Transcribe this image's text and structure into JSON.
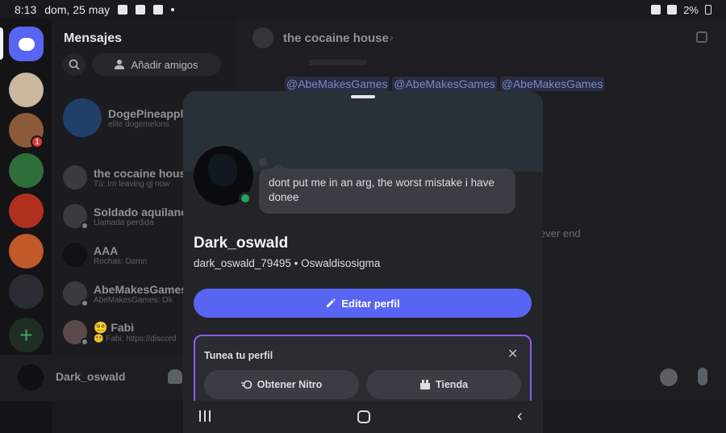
{
  "status_bar": {
    "time": "8:13",
    "date": "dom, 25 may",
    "battery": "2%"
  },
  "dm_panel": {
    "title": "Mensajes",
    "add_friends_label": "Añadir amigos",
    "items": [
      {
        "name": "DogePineapple2",
        "sub": "elite dogemelons"
      },
      {
        "name": "the cocaine house",
        "sub": "Tú: Im leaving gj now"
      },
      {
        "name": "Soldado aquilano",
        "sub": "Llamada perdida"
      },
      {
        "name": "AAA",
        "sub": "Rochas: Damn"
      },
      {
        "name": "AbeMakesGames",
        "sub": "AbeMakesGames: Ok"
      },
      {
        "name": "😵‍💫 Fabi",
        "sub": "😵‍💫 Fabi: https://discord"
      }
    ]
  },
  "server_badge": "1",
  "user_bar": {
    "username": "Dark_oswald"
  },
  "channel": {
    "title": "the cocaine house",
    "mentions": [
      "@AbeMakesGames",
      "@AbeMakesGames",
      "@AbeMakesGames"
    ],
    "message_fragment": "ever end"
  },
  "profile": {
    "status": "dont put me in an arg, the worst mistake i have donee",
    "display_name": "Dark_oswald",
    "handle_line": "dark_oswald_79495 • Oswaldisosigma",
    "edit_label": "Editar perfil",
    "tune": {
      "title": "Tunea tu perfil",
      "nitro_label": "Obtener Nitro",
      "shop_label": "Tienda"
    }
  }
}
